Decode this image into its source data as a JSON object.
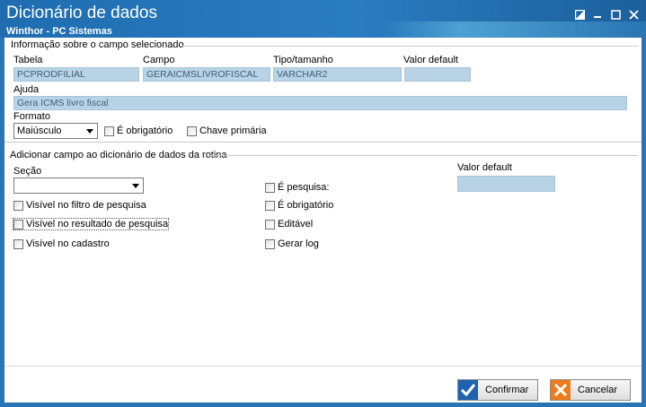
{
  "window": {
    "title": "Dicionário de dados",
    "subtitle": "Winthor - PC Sistemas",
    "controls": [
      "restore-icon",
      "minimize-icon",
      "maximize-icon",
      "close-icon"
    ]
  },
  "info_section": {
    "legend": "Informação sobre o campo selecionado",
    "tabela_label": "Tabela",
    "tabela_value": "PCPRODFILIAL",
    "campo_label": "Campo",
    "campo_value": "GERAICMSLIVROFISCAL",
    "tipo_label": "Tipo/tamanho",
    "tipo_value": "VARCHAR2",
    "valor_default_label": "Valor default",
    "valor_default_value": "",
    "ajuda_label": "Ajuda",
    "ajuda_value": "Gera ICMS livro fiscal",
    "formato_label": "Formato",
    "formato_value": "Maiúsculo",
    "obrigatorio_label": "É obrigatório",
    "chave_primaria_label": "Chave primária"
  },
  "add_section": {
    "legend": "Adicionar campo ao dicionário de dados da rotina",
    "secao_label": "Seção",
    "secao_value": "",
    "valor_default_label": "Valor default",
    "valor_default_value": "",
    "checkboxes": {
      "visivel_filtro": "Visível no filtro de pesquisa",
      "visivel_resultado": "Visível no resultado de pesquisa",
      "visivel_cadastro": "Visível no cadastro",
      "e_pesquisa": "É pesquisa:",
      "e_obrigatorio": "É obrigatório",
      "editavel": "Editável",
      "gerar_log": "Gerar log"
    }
  },
  "buttons": {
    "confirmar": "Confirmar",
    "cancelar": "Cancelar"
  },
  "colors": {
    "titlebar": "#2874b4",
    "readonly_field": "#b9d3e6",
    "confirm_icon": "#1f62b0",
    "cancel_icon": "#f07a18"
  }
}
